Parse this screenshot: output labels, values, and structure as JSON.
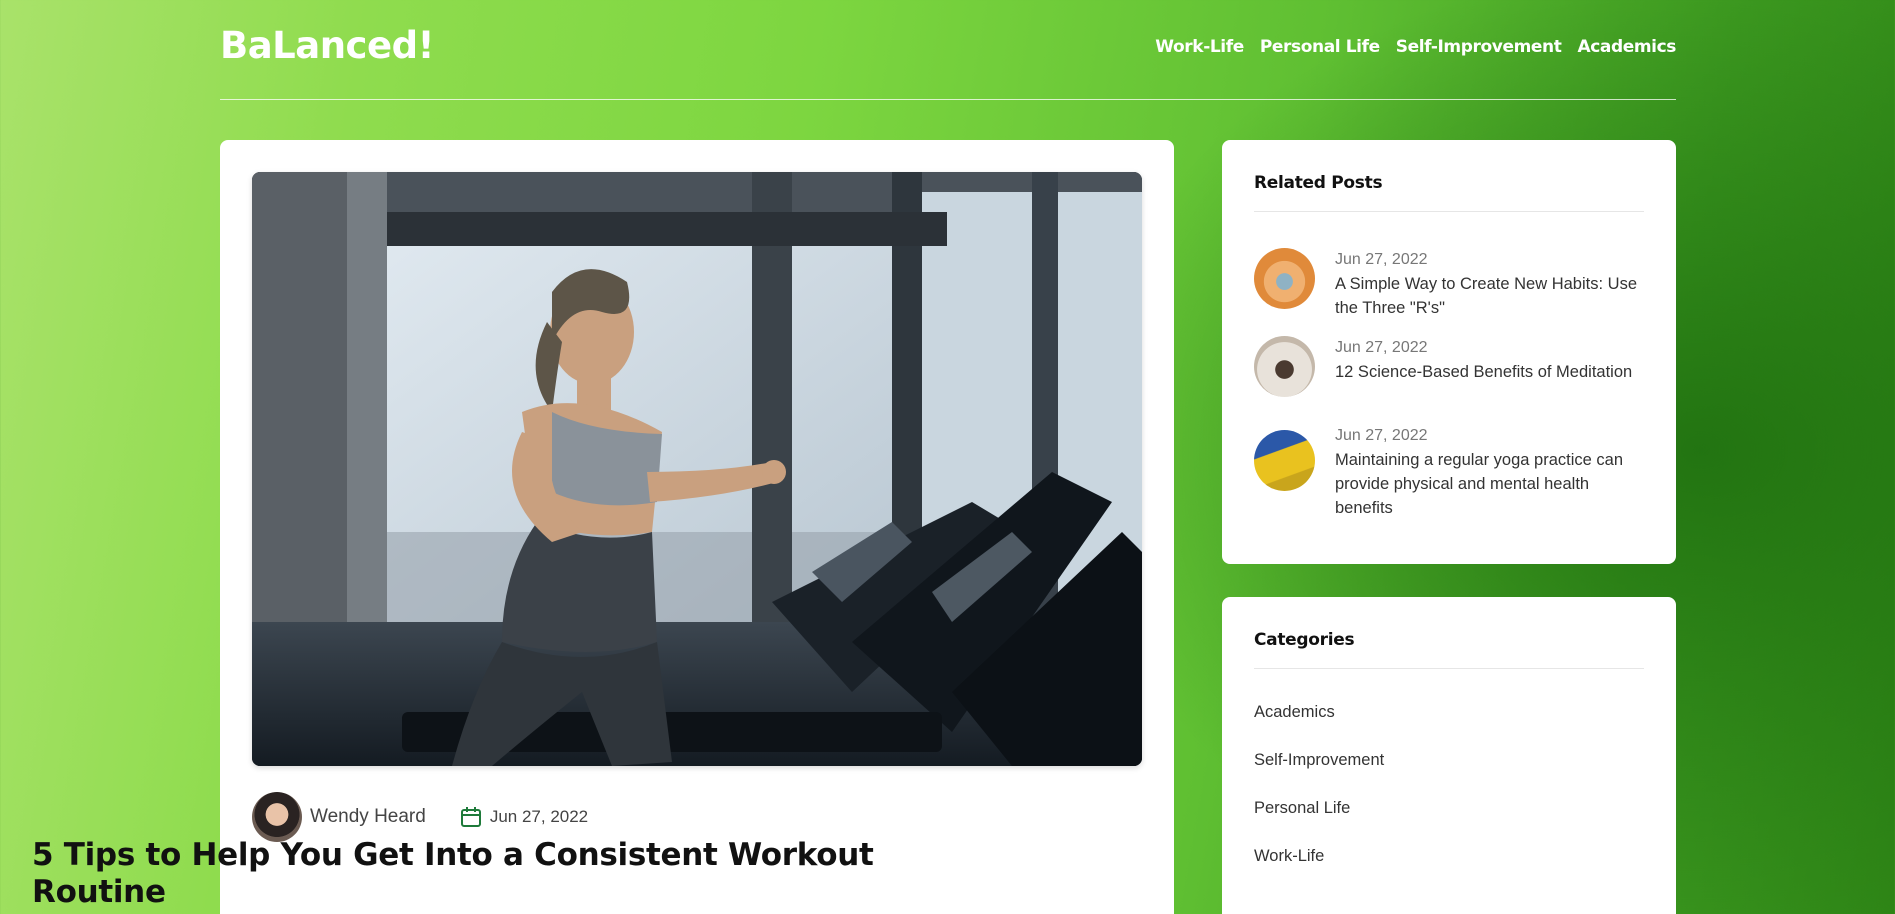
{
  "brand": {
    "logo": "BaLanced!"
  },
  "nav": [
    {
      "label": "Work-Life"
    },
    {
      "label": "Personal Life"
    },
    {
      "label": "Self-Improvement"
    },
    {
      "label": "Academics"
    }
  ],
  "article": {
    "author": "Wendy Heard",
    "date": "Jun 27, 2022",
    "title": "5 Tips to Help You Get Into a Consistent Workout Routine",
    "image_alt": "Woman running on a treadmill in a gym",
    "icon": "calendar-icon"
  },
  "related": {
    "heading": "Related Posts",
    "items": [
      {
        "date": "Jun 27, 2022",
        "title": "A Simple Way to Create New Habits: Use the Three \"R's\""
      },
      {
        "date": "Jun 27, 2022",
        "title": "12 Science-Based Benefits of Meditation"
      },
      {
        "date": "Jun 27, 2022",
        "title": "Maintaining a regular yoga practice can provide physical and mental health benefits"
      }
    ]
  },
  "categories": {
    "heading": "Categories",
    "items": [
      "Academics",
      "Self-Improvement",
      "Personal Life",
      "Work-Life"
    ]
  },
  "colors": {
    "accent_green": "#1e7a3a",
    "background_green": "#6fcf3f"
  }
}
